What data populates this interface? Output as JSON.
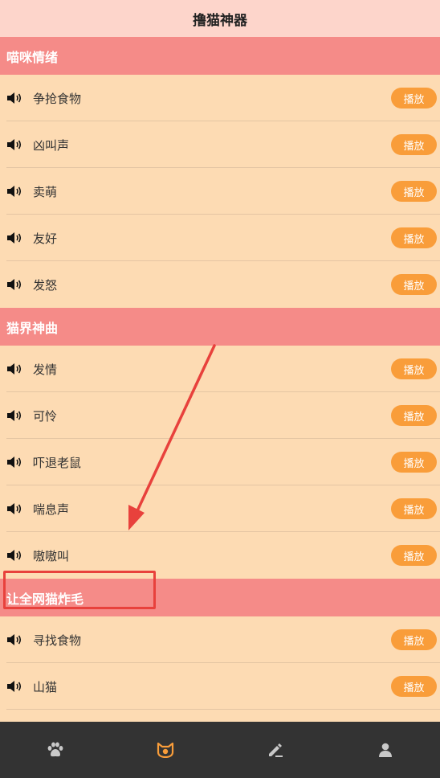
{
  "header": {
    "title": "撸猫神器"
  },
  "sections": [
    {
      "title": "喵咪情绪",
      "items": [
        {
          "label": "争抢食物",
          "button": "播放"
        },
        {
          "label": "凶叫声",
          "button": "播放"
        },
        {
          "label": "卖萌",
          "button": "播放"
        },
        {
          "label": "友好",
          "button": "播放"
        },
        {
          "label": "发怒",
          "button": "播放"
        }
      ]
    },
    {
      "title": "猫界神曲",
      "items": [
        {
          "label": "发情",
          "button": "播放"
        },
        {
          "label": "可怜",
          "button": "播放"
        },
        {
          "label": "吓退老鼠",
          "button": "播放"
        },
        {
          "label": "喘息声",
          "button": "播放"
        },
        {
          "label": "嗷嗷叫",
          "button": "播放"
        }
      ]
    },
    {
      "title": "让全网猫炸毛",
      "items": [
        {
          "label": "寻找食物",
          "button": "播放"
        },
        {
          "label": "山猫",
          "button": "播放"
        }
      ]
    }
  ],
  "tabbar": {
    "tabs": [
      {
        "icon": "paw-icon",
        "active": false
      },
      {
        "icon": "cat-face-icon",
        "active": true
      },
      {
        "icon": "edit-icon",
        "active": false
      },
      {
        "icon": "user-icon",
        "active": false
      }
    ]
  },
  "colors": {
    "background": "#fddbb3",
    "header_bg": "#fdd5cb",
    "section_bg": "#f58b88",
    "play_button": "#f99d3a",
    "tabbar_bg": "#333333",
    "annotation": "#e8413c"
  }
}
